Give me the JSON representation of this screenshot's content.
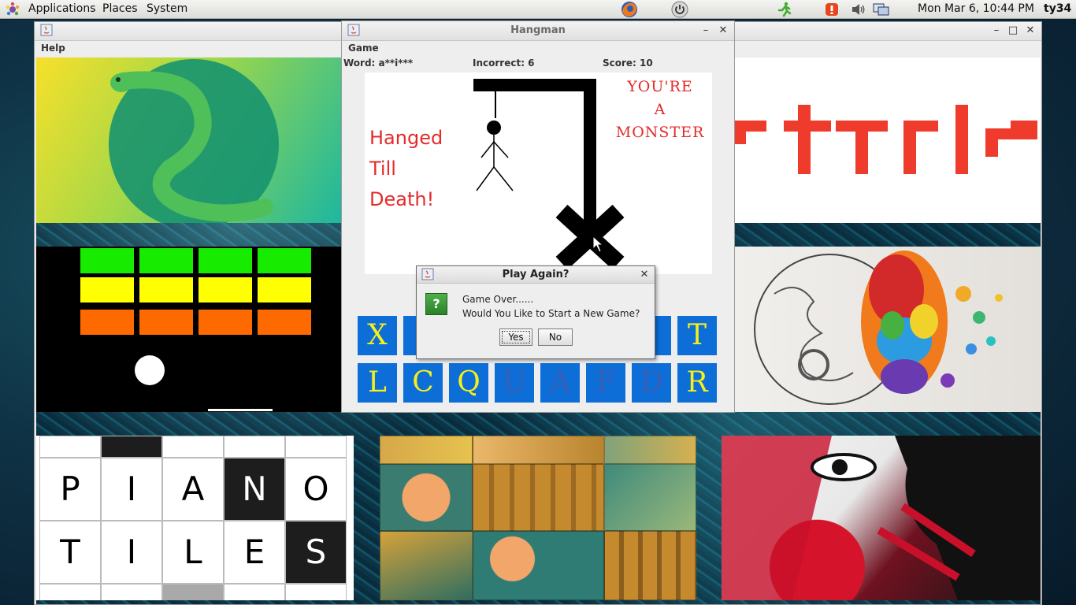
{
  "panel": {
    "menus": [
      "Applications",
      "Places",
      "System"
    ],
    "clock": "Mon Mar 6, 10:44 PM",
    "user": "ty34"
  },
  "background_window": {
    "menu": "Help",
    "tiles": {
      "tetris_letters": "TETRIS",
      "piano": {
        "row1": [
          "P",
          "I",
          "A",
          "N",
          "O"
        ],
        "row2": [
          "T",
          "I",
          "L",
          "E",
          "S"
        ]
      }
    }
  },
  "hangman": {
    "title": "Hangman",
    "menu": "Game",
    "word_label": "Word: a**i***",
    "incorrect_label": "Incorrect: 6",
    "score_label": "Score: 10",
    "hanged_lines": [
      "Hanged",
      "Till",
      "Death!"
    ],
    "monster_lines": [
      "YOU'RE",
      "A",
      "MONSTER"
    ],
    "keys_row1": [
      {
        "letter": "X",
        "used": false
      },
      {
        "letter": "",
        "used": false
      },
      {
        "letter": "",
        "used": false
      },
      {
        "letter": "",
        "used": false
      },
      {
        "letter": "",
        "used": false
      },
      {
        "letter": "",
        "used": false
      },
      {
        "letter": "",
        "used": false
      },
      {
        "letter": "T",
        "used": false
      }
    ],
    "keys_row2": [
      {
        "letter": "L",
        "used": false
      },
      {
        "letter": "C",
        "used": false
      },
      {
        "letter": "Q",
        "used": false
      },
      {
        "letter": "U",
        "used": true
      },
      {
        "letter": "A",
        "used": true
      },
      {
        "letter": "F",
        "used": true
      },
      {
        "letter": "D",
        "used": true
      },
      {
        "letter": "R",
        "used": false
      }
    ]
  },
  "dialog": {
    "title": "Play Again?",
    "icon": "?",
    "line1": "Game Over......",
    "line2": "Would You Like to Start a New Game?",
    "yes": "Yes",
    "no": "No"
  },
  "colors": {
    "key_bg": "#0d6ed8",
    "key_text": "#f6ef1a",
    "hangman_red": "#e52a2a",
    "tetris_red": "#ee3b2c"
  }
}
